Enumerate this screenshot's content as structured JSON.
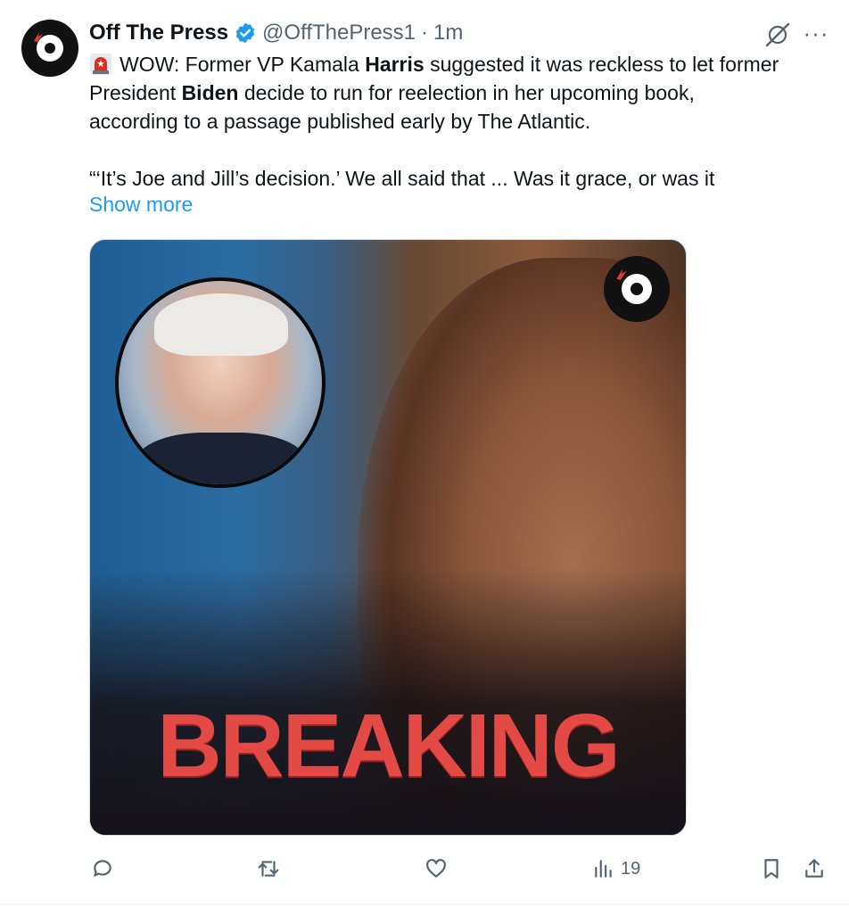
{
  "author": {
    "name": "Off The Press",
    "handle": "@OffThePress1",
    "separator": "·",
    "time": "1m",
    "verified": true,
    "avatar_icon": "off-the-press-logo"
  },
  "tweet": {
    "siren_icon": "police-siren-emoji",
    "line1_pre": "WOW: Former VP Kamala ",
    "line1_bold": "Harris",
    "line1_post": " suggested it was reckless to let former",
    "line2_pre": "President ",
    "line2_bold": "Biden",
    "line2_post": " decide to run for reelection in her upcoming book,",
    "line3": "according to a passage published early by The Atlantic.",
    "line4": "“‘It’s Joe and Jill’s decision.’ We all said that ... Was it grace, or was it",
    "show_more": "Show more"
  },
  "media": {
    "headline": "BREAKING",
    "headline_color": "#e44a45"
  },
  "actions": {
    "reply_icon": "reply-icon",
    "repost_icon": "repost-icon",
    "like_icon": "heart-icon",
    "views_icon": "views-icon",
    "views_count": "19",
    "bookmark_icon": "bookmark-icon",
    "share_icon": "share-icon"
  },
  "colors": {
    "text": "#0f1419",
    "secondary": "#536471",
    "link": "#1d9bf0",
    "verified": "#1d9bf0"
  }
}
